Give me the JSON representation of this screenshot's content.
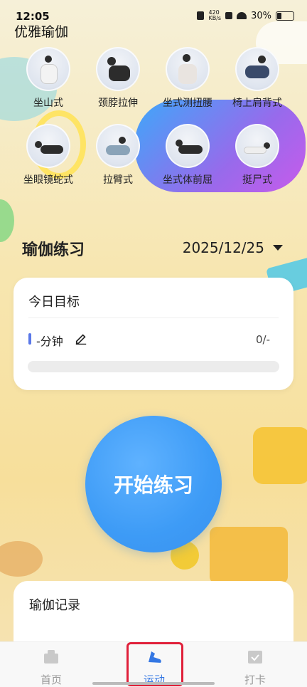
{
  "status_bar": {
    "time": "12:05",
    "network_speed": "420\nKB/s",
    "battery": "30%"
  },
  "app": {
    "title": "优雅瑜伽"
  },
  "poses": [
    {
      "label": "坐山式"
    },
    {
      "label": "颈脖拉伸"
    },
    {
      "label": "坐式测扭腰"
    },
    {
      "label": "椅上肩背式"
    },
    {
      "label": "坐眼镜蛇式"
    },
    {
      "label": "拉臂式"
    },
    {
      "label": "坐式体前屈"
    },
    {
      "label": "挺尸式"
    }
  ],
  "practice": {
    "title": "瑜伽练习",
    "date": "2025/12/25"
  },
  "goal": {
    "title": "今日目标",
    "value": "-分钟",
    "progress_text": "0/-",
    "progress_fraction": 0
  },
  "start_button": {
    "label": "开始练习"
  },
  "record": {
    "title": "瑜伽记录"
  },
  "tabs": [
    {
      "label": "首页",
      "icon": "home-icon"
    },
    {
      "label": "运动",
      "icon": "running-shoe-icon",
      "active": true
    },
    {
      "label": "打卡",
      "icon": "checkin-icon"
    }
  ],
  "colors": {
    "accent": "#3d9bf6",
    "active_tab": "#3477e3",
    "highlight_box": "#e0203a"
  }
}
